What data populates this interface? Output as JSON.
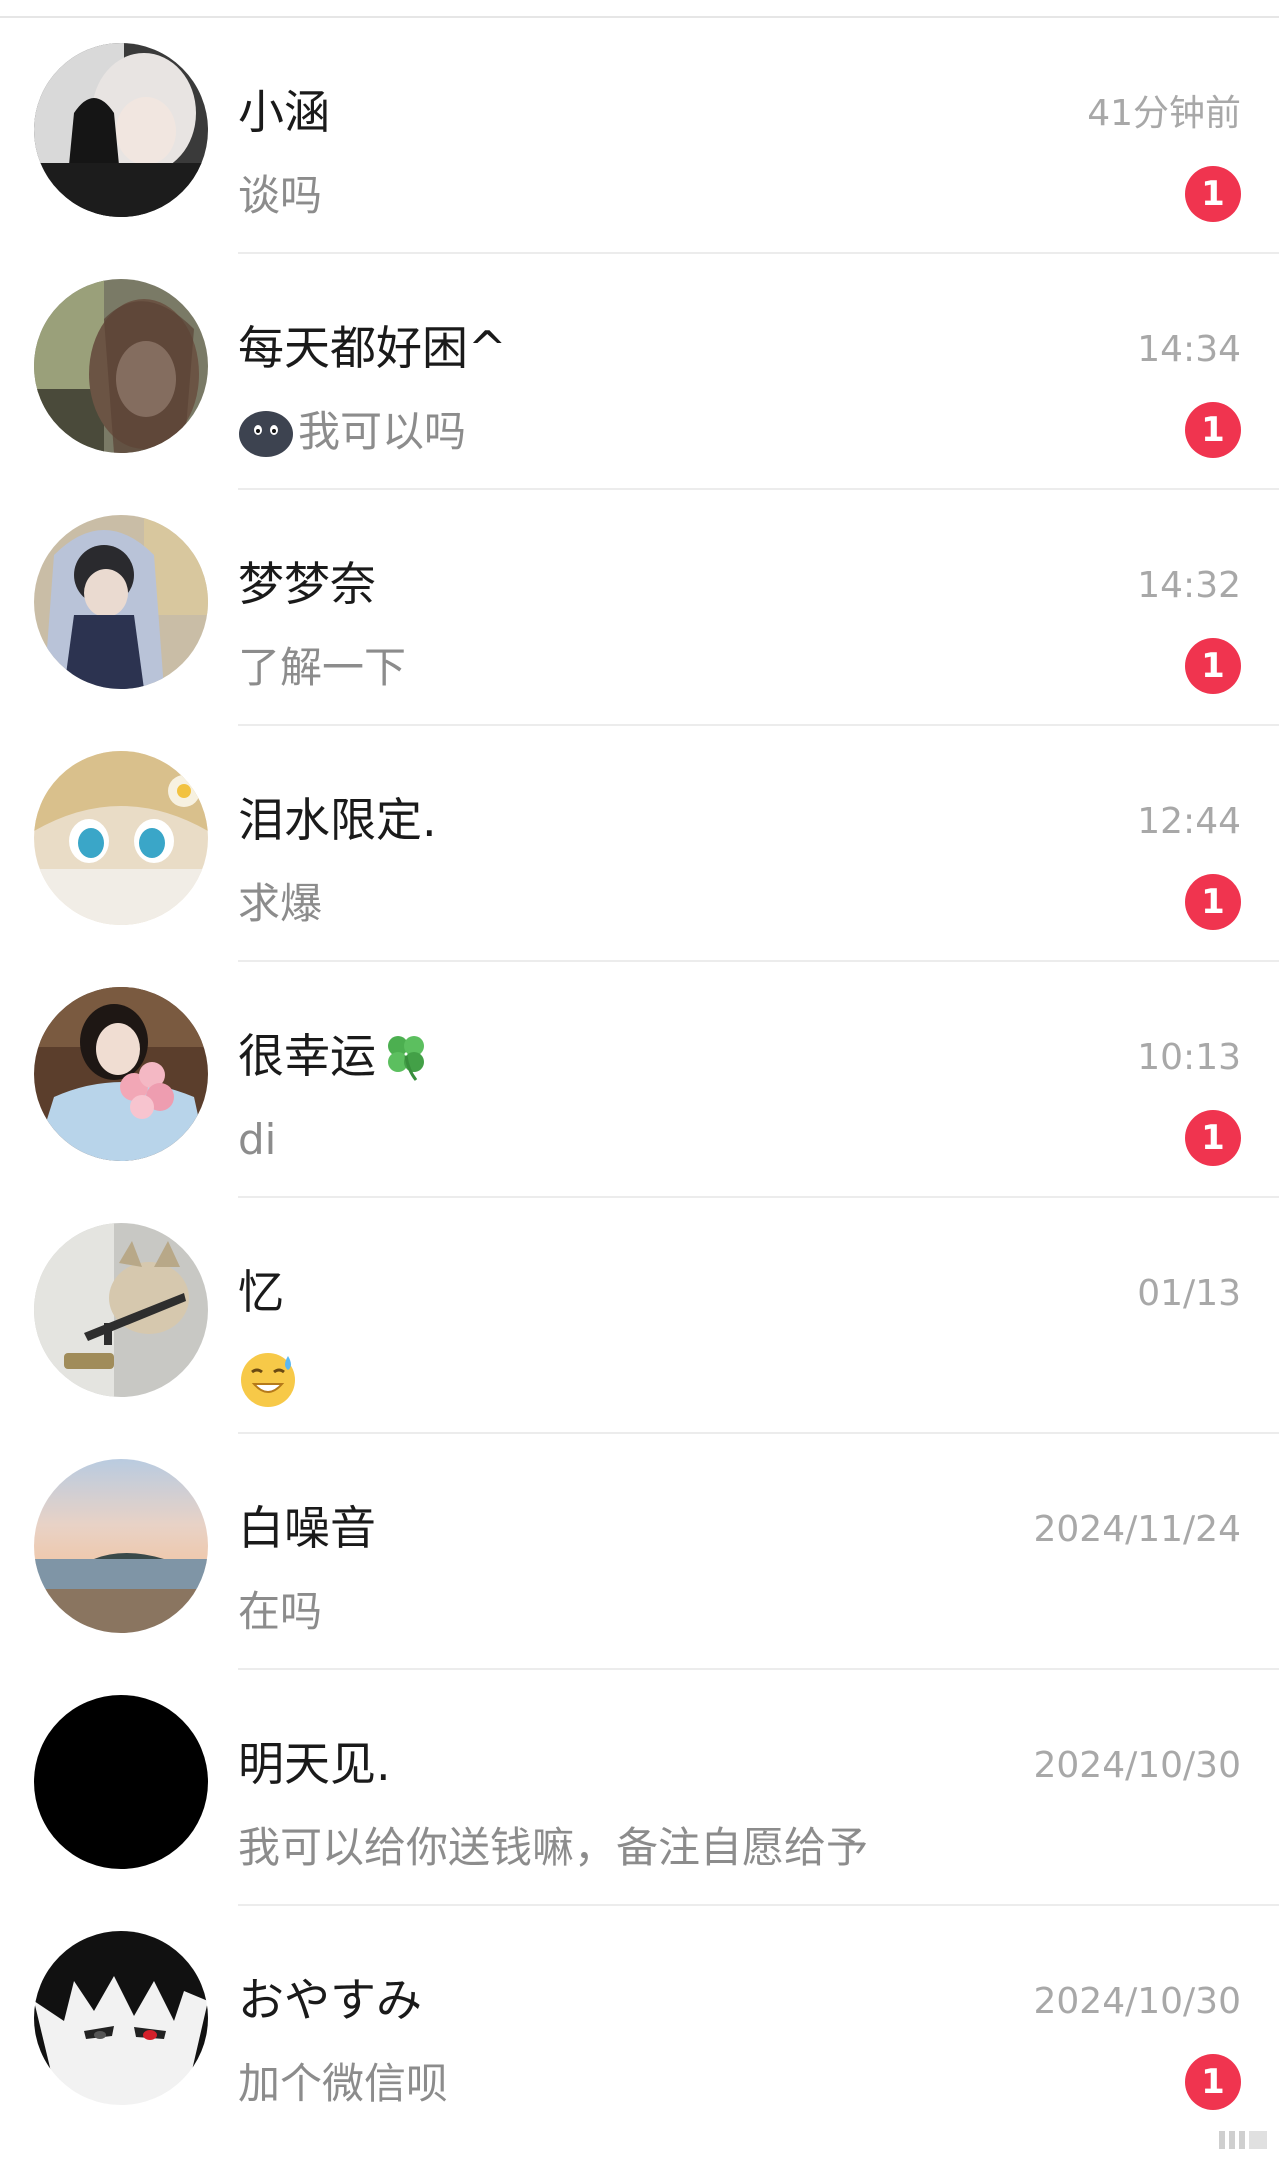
{
  "colors": {
    "badge": "#f0344f",
    "name_text": "#1a1a1a",
    "preview_text": "#8c8c8c",
    "time_text": "#a8a8a8",
    "divider": "#ececec"
  },
  "conversations": [
    {
      "name": "小涵",
      "time": "41分钟前",
      "preview": "谈吗",
      "unread": "1",
      "avatar": "girl-white-hair-avatar"
    },
    {
      "name": "每天都好困^",
      "time": "14:34",
      "preview": "我可以吗",
      "preview_emoji": "dark-face-emoji",
      "unread": "1",
      "avatar": "girl-car-selfie-avatar"
    },
    {
      "name": "梦梦奈",
      "time": "14:32",
      "preview": "了解一下",
      "unread": "1",
      "avatar": "girl-hoodie-avatar"
    },
    {
      "name": "泪水限定.",
      "time": "12:44",
      "preview": "求爆",
      "unread": "1",
      "avatar": "anime-doll-avatar"
    },
    {
      "name": "很幸运",
      "name_emoji": "four-leaf-clover-emoji",
      "time": "10:13",
      "preview": "di",
      "unread": "1",
      "avatar": "girl-flowers-avatar"
    },
    {
      "name": "忆",
      "time": "01/13",
      "preview_emoji": "grinning-sweat-emoji",
      "avatar": "cat-with-gun-avatar"
    },
    {
      "name": "白噪音",
      "time": "2024/11/24",
      "preview": "在吗",
      "avatar": "seascape-avatar"
    },
    {
      "name": "明天见.",
      "time": "2024/10/30",
      "preview": "我可以给你送钱嘛，备注自愿给予",
      "avatar": "black-avatar"
    },
    {
      "name": "おやすみ",
      "time": "2024/10/30",
      "preview": "加个微信呗",
      "unread": "1",
      "avatar": "anime-boy-avatar"
    }
  ]
}
